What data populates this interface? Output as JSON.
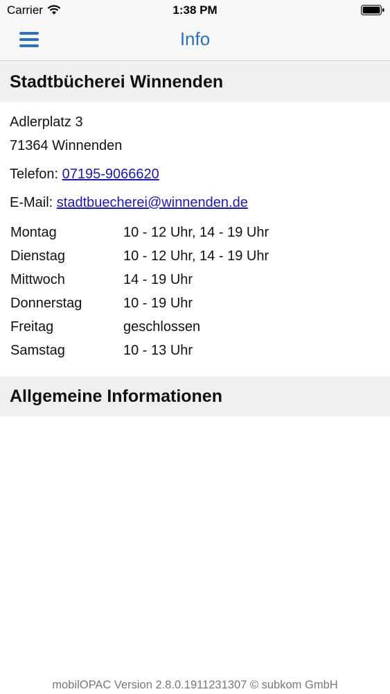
{
  "status_bar": {
    "carrier": "Carrier",
    "time": "1:38 PM"
  },
  "nav": {
    "title": "Info",
    "accent_color": "#2f6fb6",
    "menu_icon": "hamburger-menu-icon"
  },
  "library": {
    "name": "Stadtbücherei Winnenden",
    "street": "Adlerplatz 3",
    "city": "71364 Winnenden",
    "phone_label": "Telefon:",
    "phone": "07195-9066620",
    "email_label": "E-Mail:",
    "email": "stadtbuecherei@winnenden.de"
  },
  "hours": [
    {
      "day": "Montag",
      "time": "10 - 12 Uhr, 14 - 19 Uhr"
    },
    {
      "day": "Dienstag",
      "time": "10 - 12 Uhr, 14 - 19 Uhr"
    },
    {
      "day": "Mittwoch",
      "time": "14 - 19 Uhr"
    },
    {
      "day": "Donnerstag",
      "time": "10 - 19 Uhr"
    },
    {
      "day": "Freitag",
      "time": "geschlossen"
    },
    {
      "day": "Samstag",
      "time": "10 - 13 Uhr"
    }
  ],
  "general_section": {
    "title": "Allgemeine Informationen"
  },
  "footer": {
    "text": "mobilOPAC Version 2.8.0.1911231307 © subkom GmbH"
  }
}
